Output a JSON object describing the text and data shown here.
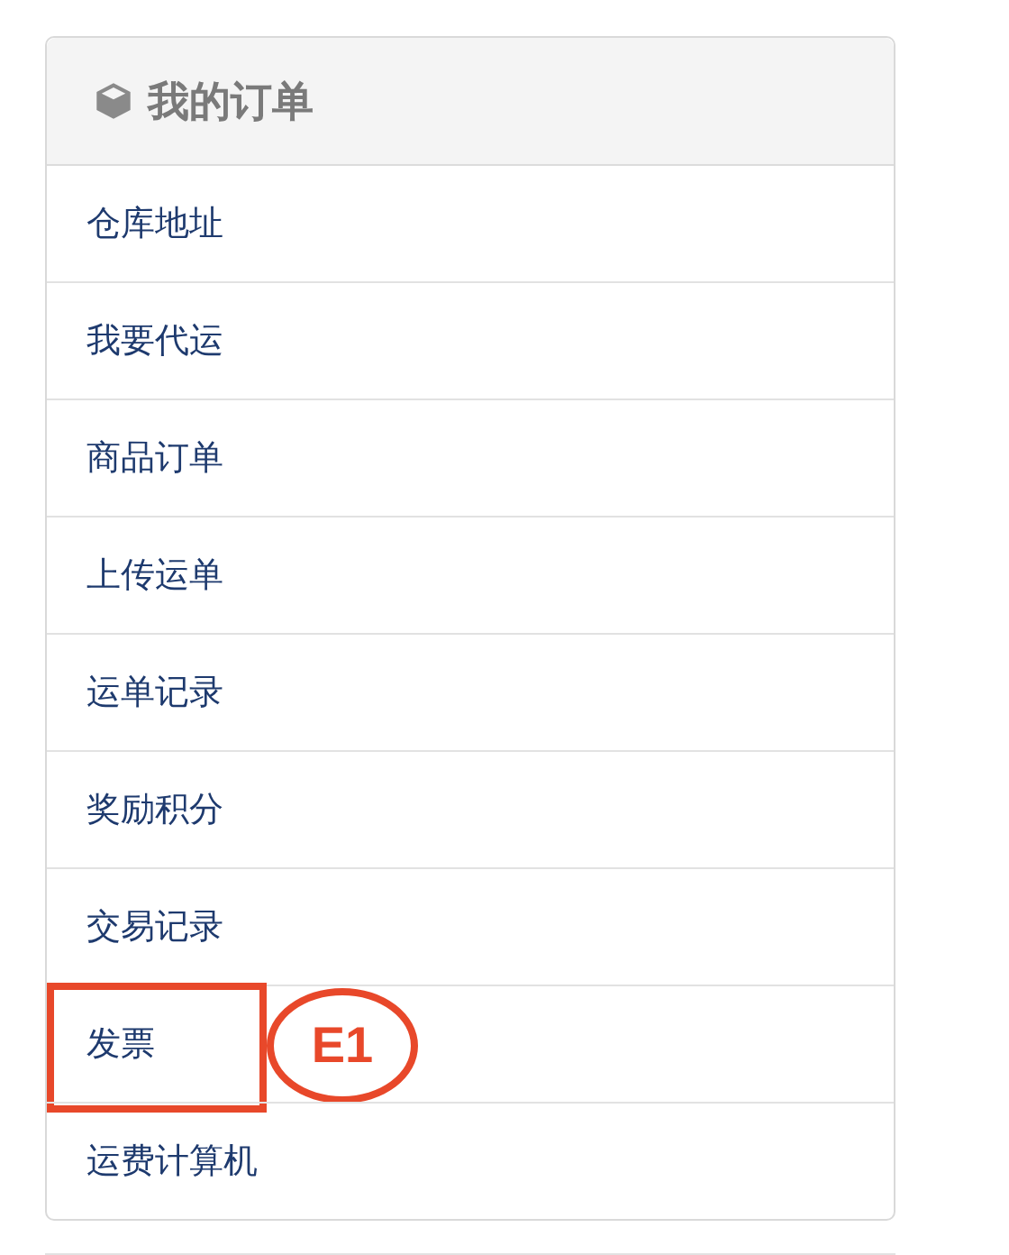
{
  "panel": {
    "title": "我的订单",
    "items": [
      {
        "label": "仓库地址"
      },
      {
        "label": "我要代运"
      },
      {
        "label": "商品订单"
      },
      {
        "label": "上传运单"
      },
      {
        "label": "运单记录"
      },
      {
        "label": "奖励积分"
      },
      {
        "label": "交易记录"
      },
      {
        "label": "发票",
        "callout": "E1"
      },
      {
        "label": "运费计算机"
      }
    ]
  }
}
